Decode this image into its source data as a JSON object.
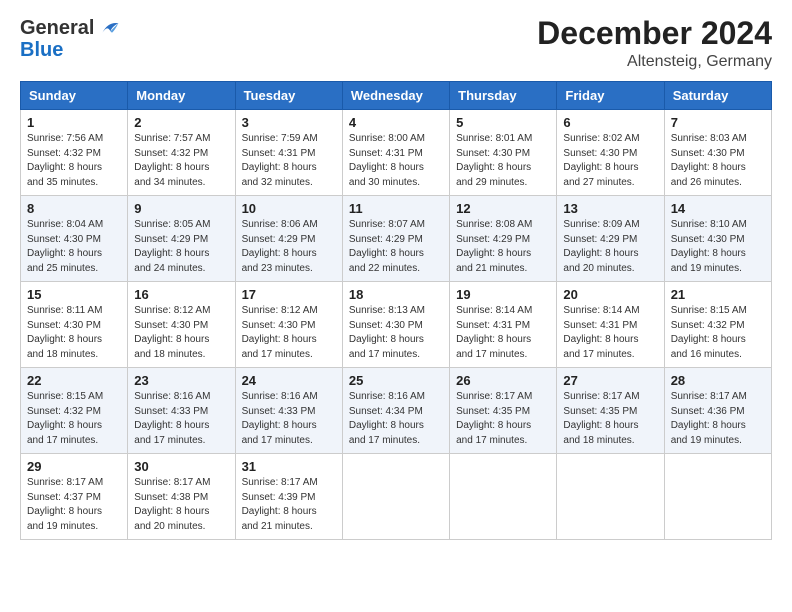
{
  "header": {
    "logo_general": "General",
    "logo_blue": "Blue",
    "month": "December 2024",
    "location": "Altensteig, Germany"
  },
  "days_of_week": [
    "Sunday",
    "Monday",
    "Tuesday",
    "Wednesday",
    "Thursday",
    "Friday",
    "Saturday"
  ],
  "weeks": [
    [
      {
        "day": 1,
        "sunrise": "7:56 AM",
        "sunset": "4:32 PM",
        "daylight": "8 hours and 35 minutes."
      },
      {
        "day": 2,
        "sunrise": "7:57 AM",
        "sunset": "4:32 PM",
        "daylight": "8 hours and 34 minutes."
      },
      {
        "day": 3,
        "sunrise": "7:59 AM",
        "sunset": "4:31 PM",
        "daylight": "8 hours and 32 minutes."
      },
      {
        "day": 4,
        "sunrise": "8:00 AM",
        "sunset": "4:31 PM",
        "daylight": "8 hours and 30 minutes."
      },
      {
        "day": 5,
        "sunrise": "8:01 AM",
        "sunset": "4:30 PM",
        "daylight": "8 hours and 29 minutes."
      },
      {
        "day": 6,
        "sunrise": "8:02 AM",
        "sunset": "4:30 PM",
        "daylight": "8 hours and 27 minutes."
      },
      {
        "day": 7,
        "sunrise": "8:03 AM",
        "sunset": "4:30 PM",
        "daylight": "8 hours and 26 minutes."
      }
    ],
    [
      {
        "day": 8,
        "sunrise": "8:04 AM",
        "sunset": "4:30 PM",
        "daylight": "8 hours and 25 minutes."
      },
      {
        "day": 9,
        "sunrise": "8:05 AM",
        "sunset": "4:29 PM",
        "daylight": "8 hours and 24 minutes."
      },
      {
        "day": 10,
        "sunrise": "8:06 AM",
        "sunset": "4:29 PM",
        "daylight": "8 hours and 23 minutes."
      },
      {
        "day": 11,
        "sunrise": "8:07 AM",
        "sunset": "4:29 PM",
        "daylight": "8 hours and 22 minutes."
      },
      {
        "day": 12,
        "sunrise": "8:08 AM",
        "sunset": "4:29 PM",
        "daylight": "8 hours and 21 minutes."
      },
      {
        "day": 13,
        "sunrise": "8:09 AM",
        "sunset": "4:29 PM",
        "daylight": "8 hours and 20 minutes."
      },
      {
        "day": 14,
        "sunrise": "8:10 AM",
        "sunset": "4:30 PM",
        "daylight": "8 hours and 19 minutes."
      }
    ],
    [
      {
        "day": 15,
        "sunrise": "8:11 AM",
        "sunset": "4:30 PM",
        "daylight": "8 hours and 18 minutes."
      },
      {
        "day": 16,
        "sunrise": "8:12 AM",
        "sunset": "4:30 PM",
        "daylight": "8 hours and 18 minutes."
      },
      {
        "day": 17,
        "sunrise": "8:12 AM",
        "sunset": "4:30 PM",
        "daylight": "8 hours and 17 minutes."
      },
      {
        "day": 18,
        "sunrise": "8:13 AM",
        "sunset": "4:30 PM",
        "daylight": "8 hours and 17 minutes."
      },
      {
        "day": 19,
        "sunrise": "8:14 AM",
        "sunset": "4:31 PM",
        "daylight": "8 hours and 17 minutes."
      },
      {
        "day": 20,
        "sunrise": "8:14 AM",
        "sunset": "4:31 PM",
        "daylight": "8 hours and 17 minutes."
      },
      {
        "day": 21,
        "sunrise": "8:15 AM",
        "sunset": "4:32 PM",
        "daylight": "8 hours and 16 minutes."
      }
    ],
    [
      {
        "day": 22,
        "sunrise": "8:15 AM",
        "sunset": "4:32 PM",
        "daylight": "8 hours and 17 minutes."
      },
      {
        "day": 23,
        "sunrise": "8:16 AM",
        "sunset": "4:33 PM",
        "daylight": "8 hours and 17 minutes."
      },
      {
        "day": 24,
        "sunrise": "8:16 AM",
        "sunset": "4:33 PM",
        "daylight": "8 hours and 17 minutes."
      },
      {
        "day": 25,
        "sunrise": "8:16 AM",
        "sunset": "4:34 PM",
        "daylight": "8 hours and 17 minutes."
      },
      {
        "day": 26,
        "sunrise": "8:17 AM",
        "sunset": "4:35 PM",
        "daylight": "8 hours and 17 minutes."
      },
      {
        "day": 27,
        "sunrise": "8:17 AM",
        "sunset": "4:35 PM",
        "daylight": "8 hours and 18 minutes."
      },
      {
        "day": 28,
        "sunrise": "8:17 AM",
        "sunset": "4:36 PM",
        "daylight": "8 hours and 19 minutes."
      }
    ],
    [
      {
        "day": 29,
        "sunrise": "8:17 AM",
        "sunset": "4:37 PM",
        "daylight": "8 hours and 19 minutes."
      },
      {
        "day": 30,
        "sunrise": "8:17 AM",
        "sunset": "4:38 PM",
        "daylight": "8 hours and 20 minutes."
      },
      {
        "day": 31,
        "sunrise": "8:17 AM",
        "sunset": "4:39 PM",
        "daylight": "8 hours and 21 minutes."
      },
      null,
      null,
      null,
      null
    ]
  ]
}
